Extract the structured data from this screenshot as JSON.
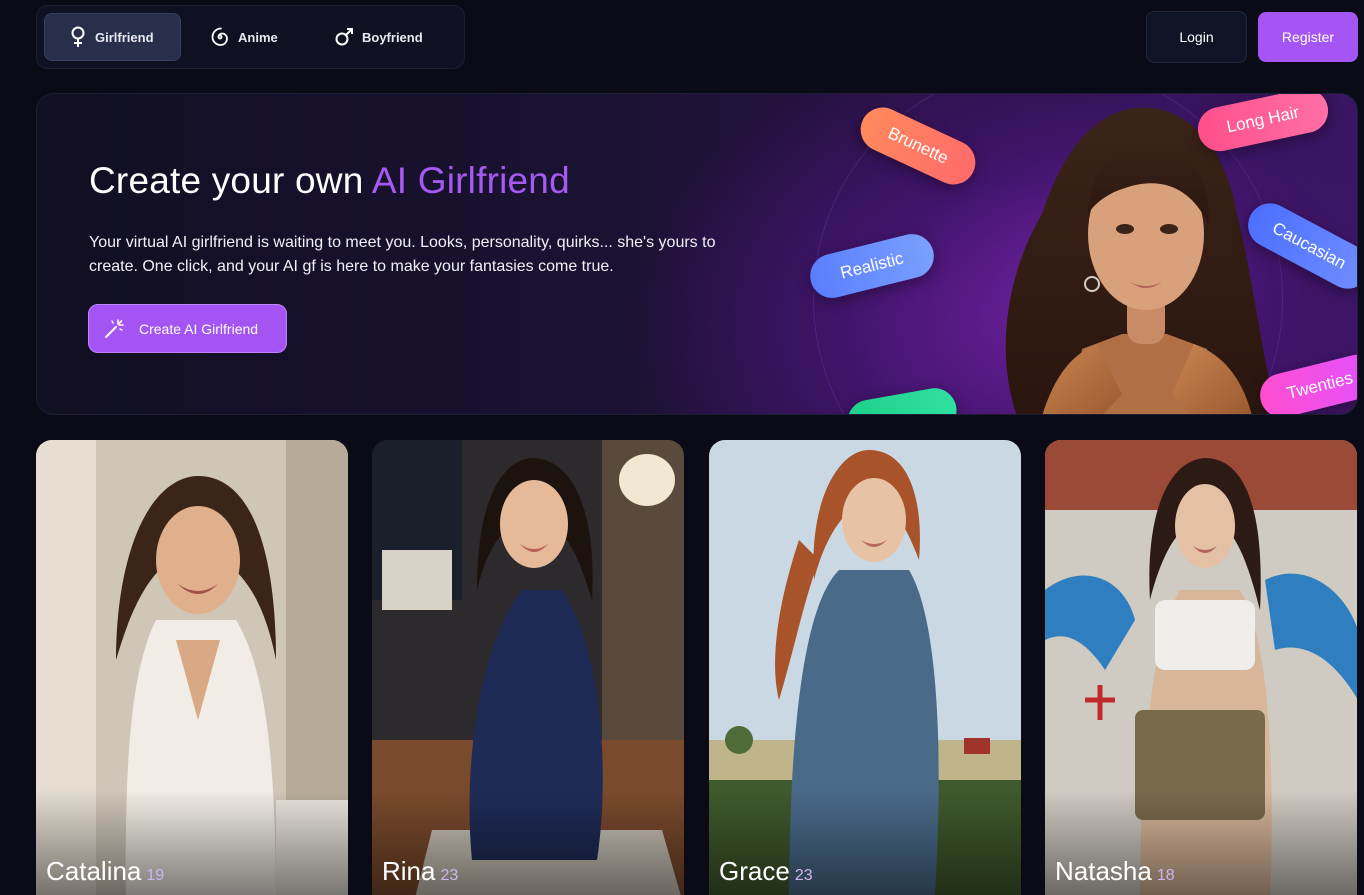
{
  "nav": {
    "tabs": [
      {
        "label": "Girlfriend",
        "icon": "female-symbol-icon",
        "active": true
      },
      {
        "label": "Anime",
        "icon": "spiral-icon",
        "active": false
      },
      {
        "label": "Boyfriend",
        "icon": "male-symbol-icon",
        "active": false
      }
    ],
    "login_label": "Login",
    "register_label": "Register"
  },
  "hero": {
    "title_prefix": "Create your own ",
    "title_accent": "AI Girlfriend",
    "description": "Your virtual AI girlfriend is waiting to meet you. Looks, personality, quirks... she's yours to create. One click, and your AI gf is here to make your fantasies come true.",
    "cta_label": "Create AI Girlfriend",
    "cta_icon": "magic-wand-icon",
    "tags": [
      "Brunette",
      "Long Hair",
      "Realistic",
      "Caucasian",
      "Twenties"
    ]
  },
  "characters": [
    {
      "name": "Catalina",
      "age": "19"
    },
    {
      "name": "Rina",
      "age": "23"
    },
    {
      "name": "Grace",
      "age": "23"
    },
    {
      "name": "Natasha",
      "age": "18"
    }
  ],
  "colors": {
    "background": "#0b0b18",
    "accent": "#a555f3",
    "nav_active": "#272f4a"
  }
}
